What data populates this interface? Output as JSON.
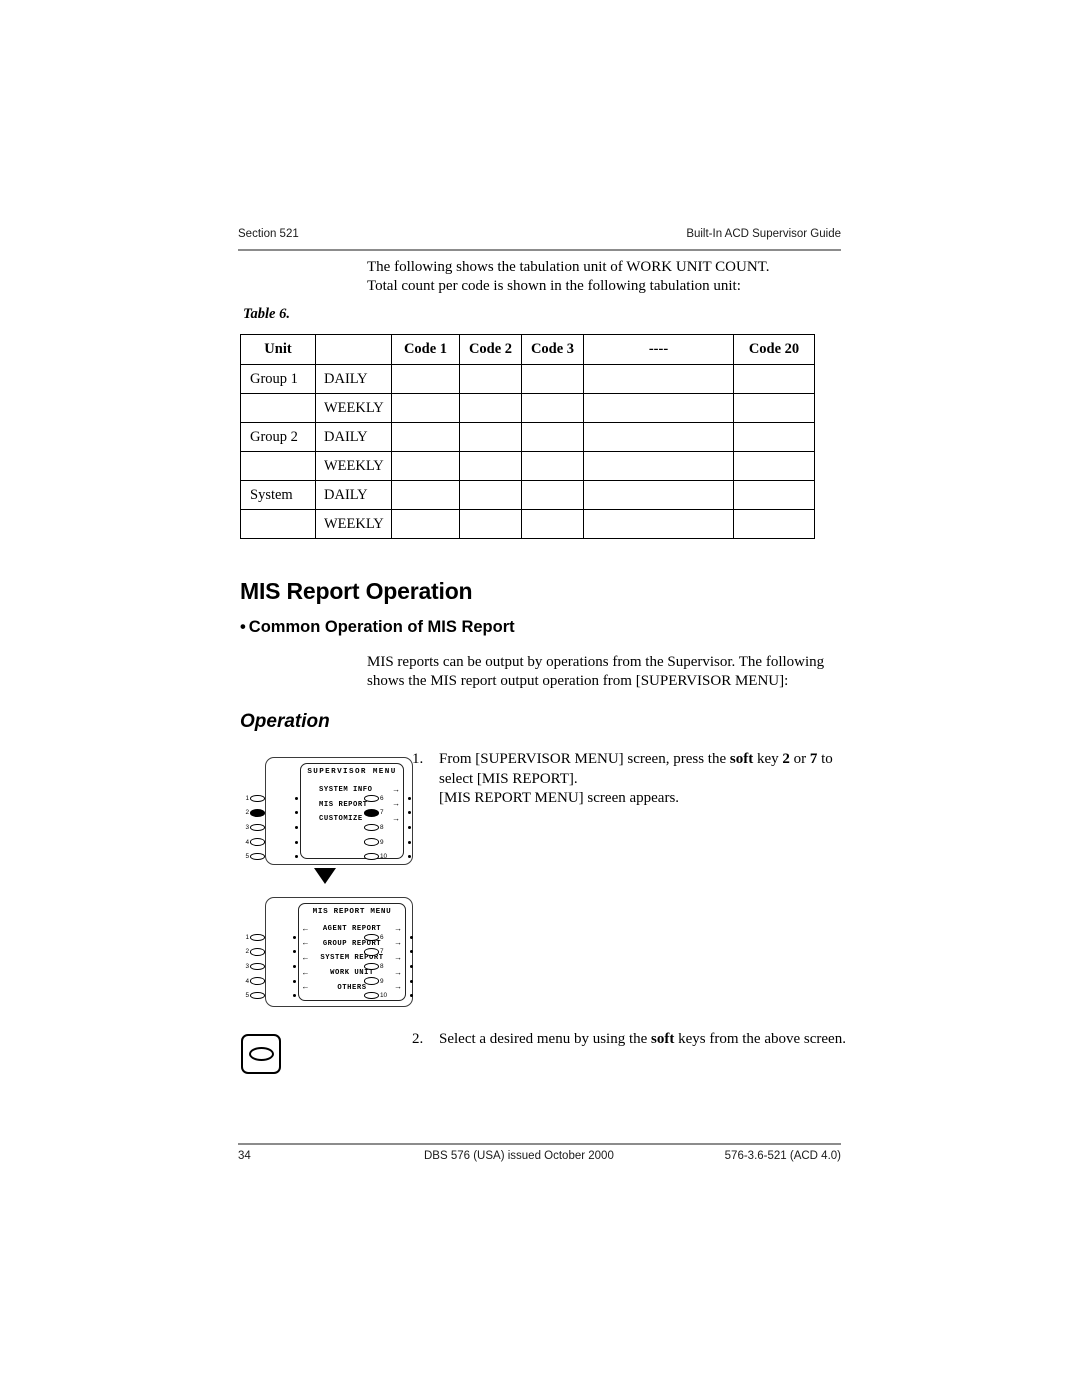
{
  "header": {
    "left": "Section 521",
    "right": "Built-In ACD Supervisor Guide"
  },
  "intro": {
    "line1": "The following shows the tabulation unit of WORK UNIT COUNT.",
    "line2": "Total count per code is shown in the following tabulation unit:"
  },
  "table": {
    "caption": "Table 6.",
    "headers": [
      "Unit",
      "",
      "Code 1",
      "Code 2",
      "Code 3",
      "----",
      "Code 20"
    ],
    "rows": [
      {
        "unit": "Group 1",
        "period": "DAILY",
        "cells": [
          "",
          "",
          "",
          "",
          ""
        ]
      },
      {
        "unit": "",
        "period": "WEEKLY",
        "cells": [
          "",
          "",
          "",
          "",
          ""
        ]
      },
      {
        "unit": "Group 2",
        "period": "DAILY",
        "cells": [
          "",
          "",
          "",
          "",
          ""
        ]
      },
      {
        "unit": "",
        "period": "WEEKLY",
        "cells": [
          "",
          "",
          "",
          "",
          ""
        ]
      },
      {
        "unit": "System",
        "period": "DAILY",
        "cells": [
          "",
          "",
          "",
          "",
          ""
        ]
      },
      {
        "unit": "",
        "period": "WEEKLY",
        "cells": [
          "",
          "",
          "",
          "",
          ""
        ]
      }
    ]
  },
  "headings": {
    "h1": "MIS Report Operation",
    "bullet": "•",
    "h2": "Common Operation of MIS Report",
    "h3": "Operation"
  },
  "body_para": "MIS reports can be output by operations from the Supervisor. The following shows the MIS report output operation from [SUPERVISOR MENU]:",
  "steps": [
    {
      "num": "1.",
      "text_html": "From [SUPERVISOR MENU] screen, press the <b>soft</b> key <b>2</b> or <b>7</b> to select [MIS REPORT].<br>[MIS REPORT MENU] screen appears."
    },
    {
      "num": "2.",
      "text_html": "Select a desired menu by using the <b>soft</b> keys from the above screen."
    }
  ],
  "diagrams": [
    {
      "id": "supervisor-menu",
      "screen_title": "SUPERVISOR  MENU",
      "rows": [
        {
          "arrow_left": "",
          "label": "SYSTEM INFO",
          "arrow_right": "→"
        },
        {
          "arrow_left": "",
          "label": "MIS REPORT",
          "arrow_right": "→"
        },
        {
          "arrow_left": "",
          "label": "CUSTOMIZE",
          "arrow_right": "→"
        },
        {
          "arrow_left": "",
          "label": "",
          "arrow_right": ""
        },
        {
          "arrow_left": "",
          "label": "",
          "arrow_right": ""
        }
      ],
      "left_keys": [
        {
          "num": "1",
          "filled": false
        },
        {
          "num": "2",
          "filled": true
        },
        {
          "num": "3",
          "filled": false
        },
        {
          "num": "4",
          "filled": false
        },
        {
          "num": "5",
          "filled": false
        }
      ],
      "right_keys": [
        {
          "num": "6",
          "filled": false
        },
        {
          "num": "7",
          "filled": true
        },
        {
          "num": "8",
          "filled": false
        },
        {
          "num": "9",
          "filled": false
        },
        {
          "num": "10",
          "filled": false
        }
      ]
    },
    {
      "id": "mis-report-menu",
      "screen_title": "MIS REPORT MENU",
      "rows": [
        {
          "arrow_left": "←",
          "label": "AGENT REPORT",
          "arrow_right": "→"
        },
        {
          "arrow_left": "←",
          "label": "GROUP REPORT",
          "arrow_right": "→"
        },
        {
          "arrow_left": "←",
          "label": "SYSTEM REPORT",
          "arrow_right": "→"
        },
        {
          "arrow_left": "←",
          "label": "WORK UNIT",
          "arrow_right": "→"
        },
        {
          "arrow_left": "←",
          "label": "OTHERS",
          "arrow_right": "→"
        }
      ],
      "left_keys": [
        {
          "num": "1",
          "filled": false
        },
        {
          "num": "2",
          "filled": false
        },
        {
          "num": "3",
          "filled": false
        },
        {
          "num": "4",
          "filled": false
        },
        {
          "num": "5",
          "filled": false
        }
      ],
      "right_keys": [
        {
          "num": "6",
          "filled": false
        },
        {
          "num": "7",
          "filled": false
        },
        {
          "num": "8",
          "filled": false
        },
        {
          "num": "9",
          "filled": false
        },
        {
          "num": "10",
          "filled": false
        }
      ]
    }
  ],
  "footer": {
    "page": "34",
    "center": "DBS 576 (USA) issued October 2000",
    "right": "576-3.6-521 (ACD 4.0)"
  }
}
